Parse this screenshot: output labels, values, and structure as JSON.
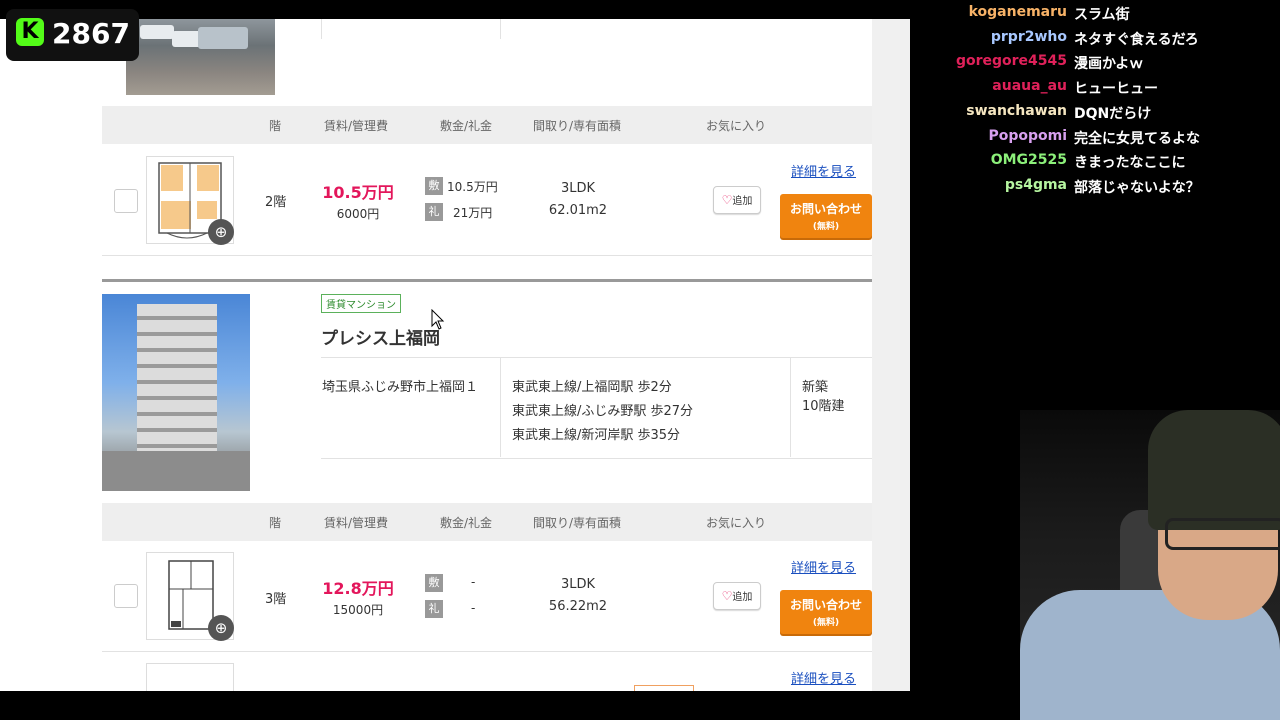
{
  "viewer_counter": {
    "count": "2867",
    "logo_letter": "K"
  },
  "chat": {
    "messages": [
      {
        "user": "koganemaru",
        "text": "スラム街",
        "color": "#f7b267"
      },
      {
        "user": "prpr2who",
        "text": "ネタすぐ食えるだろ",
        "color": "#a8c8ff"
      },
      {
        "user": "goregore4545",
        "text": "漫画かよｗ",
        "color": "#e0215a"
      },
      {
        "user": "auaua_au",
        "text": "ヒューヒュー",
        "color": "#e0215a"
      },
      {
        "user": "swanchawan",
        "text": "DQNだらけ",
        "color": "#f5e6c0"
      },
      {
        "user": "Popopomi",
        "text": "完全に女見てるよな",
        "color": "#d8a0f0"
      },
      {
        "user": "OMG2525",
        "text": "きまったなここに",
        "color": "#8cf07a"
      },
      {
        "user": "ps4gma",
        "text": "部落じゃないよな？",
        "color": "#b6f5a0"
      }
    ]
  },
  "listing_header": {
    "floor": "階",
    "rent": "賃料/管理費",
    "deposit": "敷金/礼金",
    "layout": "間取り/専有面積",
    "favorite": "お気に入り"
  },
  "units": [
    {
      "floor": "2階",
      "rent": "10.5万円",
      "admin_fee": "6000円",
      "deposit_badge": "敷",
      "deposit": "10.5万円",
      "key_money_badge": "礼",
      "key_money": "21万円",
      "layout": "3LDK",
      "area": "62.01m2",
      "favorite_label": "追加",
      "detail_link": "詳細を見る",
      "inquiry_label": "お問い合わせ",
      "inquiry_sub": "(無料)"
    },
    {
      "floor": "3階",
      "rent": "12.8万円",
      "admin_fee": "15000円",
      "deposit_badge": "敷",
      "deposit": "-",
      "key_money_badge": "礼",
      "key_money": "-",
      "layout": "3LDK",
      "area": "56.22m2",
      "favorite_label": "追加",
      "detail_link": "詳細を見る",
      "inquiry_label": "お問い合わせ",
      "inquiry_sub": "(無料)"
    }
  ],
  "building": {
    "type_badge": "賃貸マンション",
    "name": "プレシス上福岡",
    "address": "埼玉県ふじみ野市上福岡１",
    "stations": [
      "東武東上線/上福岡駅 歩2分",
      "東武東上線/ふじみ野駅 歩27分",
      "東武東上線/新河岸駅 歩35分"
    ],
    "age": "新築",
    "floors": "10階建"
  },
  "partial_row": {
    "detail_link": "詳細を見る"
  },
  "colors": {
    "rent": "#e3165b",
    "inquiry": "#f0840f",
    "link": "#1a4fbf",
    "kick_green": "#53fc18"
  }
}
